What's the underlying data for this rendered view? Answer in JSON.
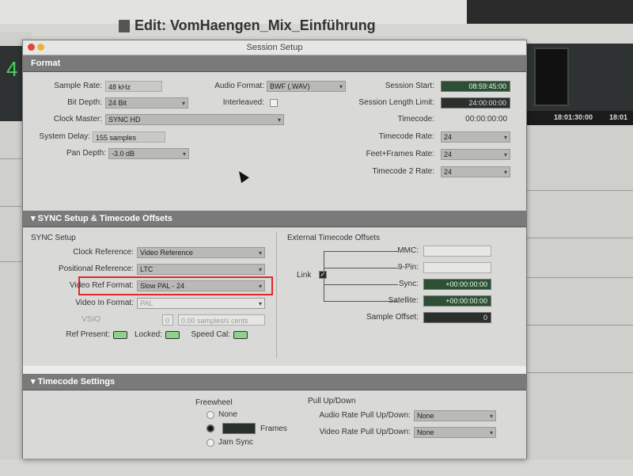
{
  "window_title": "Edit: VomHaengen_Mix_Einführung",
  "background": {
    "left_number": "4",
    "right_times": [
      "18:01:30:00",
      "18:01"
    ]
  },
  "dialog": {
    "title": "Session Setup",
    "format": {
      "header": "Format",
      "sample_rate_label": "Sample Rate:",
      "sample_rate_value": "48 kHz",
      "bit_depth_label": "Bit Depth:",
      "bit_depth_value": "24 Bit",
      "clock_master_label": "Clock Master:",
      "clock_master_value": "SYNC HD",
      "system_delay_label": "System Delay:",
      "system_delay_value": "155 samples",
      "pan_depth_label": "Pan Depth:",
      "pan_depth_value": "-3.0 dB",
      "audio_format_label": "Audio Format:",
      "audio_format_value": "BWF (.WAV)",
      "interleaved_label": "Interleaved:",
      "session_start_label": "Session Start:",
      "session_start_value": "08:59:45:00",
      "session_length_label": "Session Length Limit:",
      "session_length_value": "24:00:00:00",
      "timecode_label": "Timecode:",
      "timecode_value": "00:00:00:00",
      "timecode_rate_label": "Timecode Rate:",
      "timecode_rate_value": "24",
      "feet_frames_label": "Feet+Frames Rate:",
      "feet_frames_value": "24",
      "timecode2_label": "Timecode 2 Rate:",
      "timecode2_value": "24"
    },
    "sync": {
      "header": "SYNC Setup & Timecode Offsets",
      "sync_setup_label": "SYNC Setup",
      "clock_reference_label": "Clock Reference:",
      "clock_reference_value": "Video Reference",
      "positional_reference_label": "Positional Reference:",
      "positional_reference_value": "LTC",
      "video_ref_format_label": "Video Ref Format:",
      "video_ref_format_value": "Slow PAL - 24",
      "video_in_format_label": "Video In Format:",
      "video_in_format_value": "PAL",
      "vsio_label": "VSIO",
      "vsio_value": "0",
      "vsio_unit": "0.00 samples/s cents",
      "ref_present_label": "Ref Present:",
      "locked_label": "Locked:",
      "speed_cal_label": "Speed Cal:",
      "external_offsets_label": "External Timecode Offsets",
      "mmc_label": "MMC:",
      "nine_pin_label": "9-Pin:",
      "sync_label": "Sync:",
      "sync_value": "+00:00:00:00",
      "satellite_label": "Satellite:",
      "satellite_value": "+00:00:00:00",
      "link_label": "Link",
      "sample_offset_label": "Sample Offset:",
      "sample_offset_value": "0"
    },
    "timecode_settings": {
      "header": "Timecode Settings",
      "freewheel_label": "Freewheel",
      "none_label": "None",
      "frames_label": "Frames",
      "jam_sync_label": "Jam Sync",
      "pull_label": "Pull Up/Down",
      "audio_pull_label": "Audio Rate Pull Up/Down:",
      "audio_pull_value": "None",
      "video_pull_label": "Video Rate Pull Up/Down:",
      "video_pull_value": "None"
    }
  }
}
